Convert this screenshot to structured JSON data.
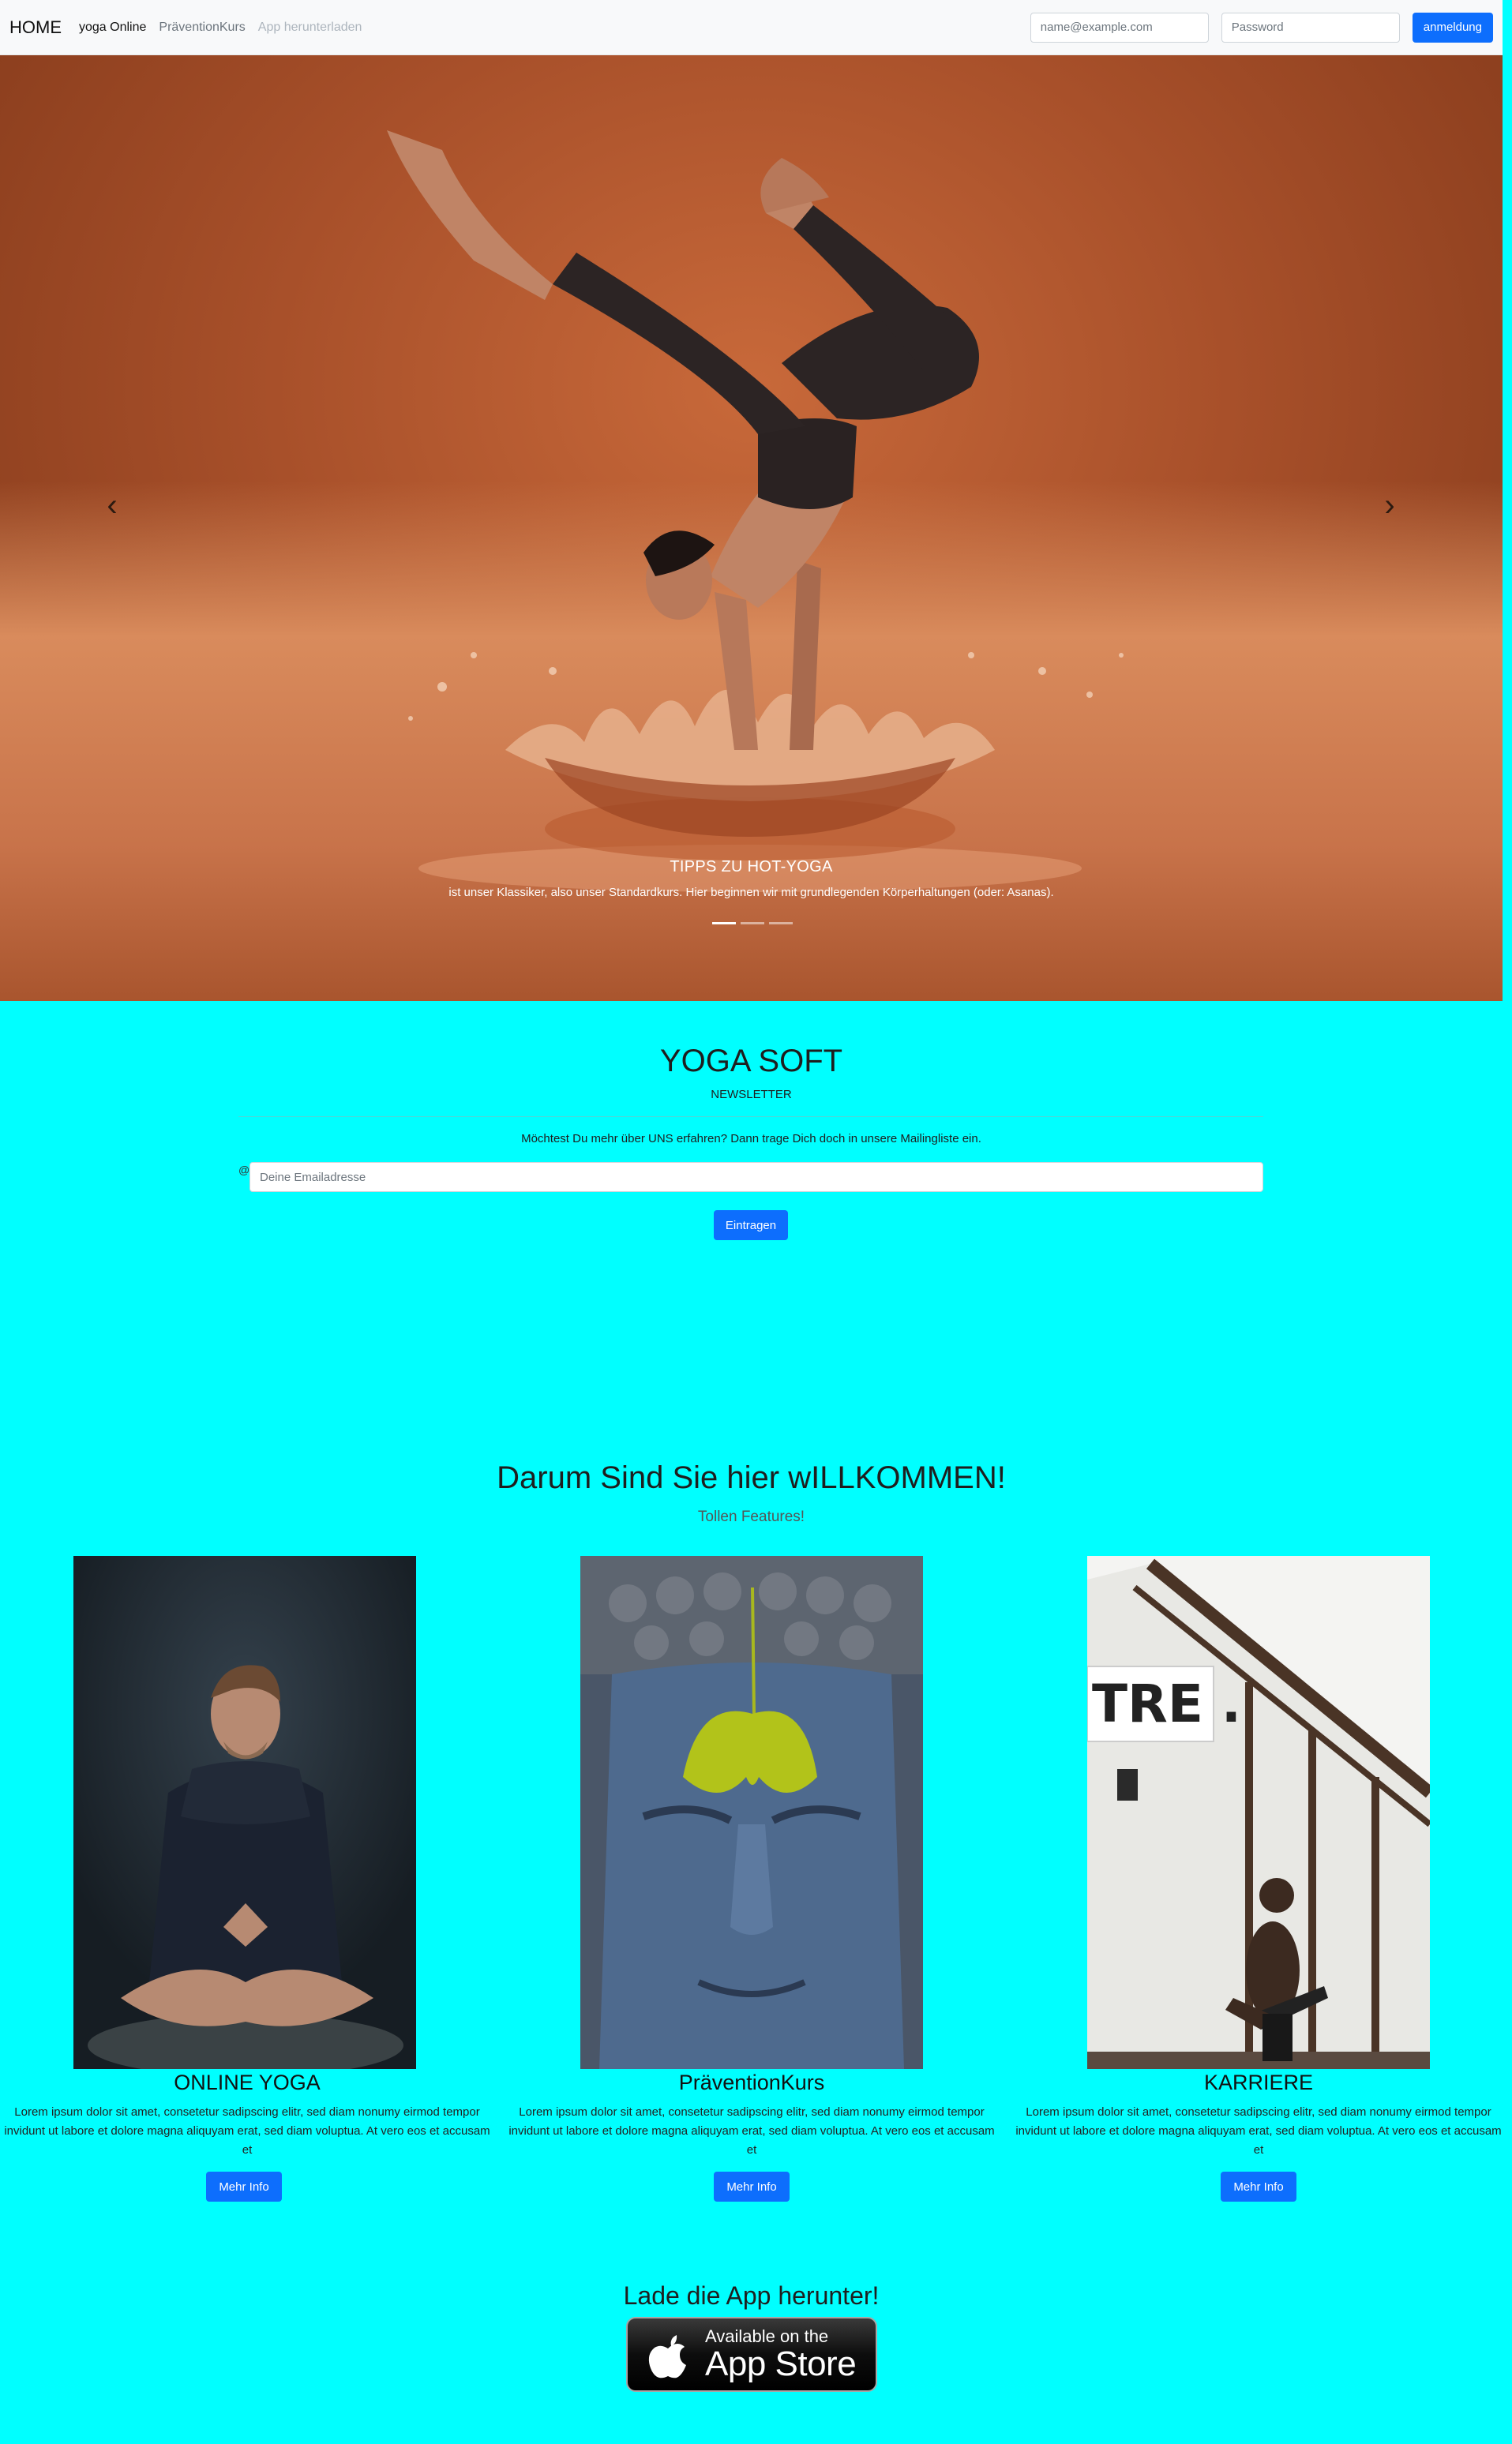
{
  "navbar": {
    "brand": "HOME",
    "links": [
      "yoga Online",
      "PräventionKurs",
      "App herunterladen"
    ],
    "email_placeholder": "name@example.com",
    "password_placeholder": "Password",
    "login_label": "anmeldung"
  },
  "carousel": {
    "prev_icon": "‹",
    "next_icon": "›",
    "caption_title": "TIPPS ZU HOT-YOGA",
    "caption_text": "ist unser Klassiker, also unser Standardkurs. Hier beginnen wir mit grundlegenden Körperhaltungen (oder: Asanas).",
    "slide_count": 3,
    "active_slide": 1
  },
  "newsletter": {
    "title": "YOGA SOFT",
    "label": "NEWSLETTER",
    "text": "Möchtest Du mehr über UNS erfahren? Dann trage Dich doch in unsere Mailingliste ein.",
    "at_sign": "@",
    "email_placeholder": "Deine Emailadresse",
    "submit_label": "Eintragen"
  },
  "features": {
    "title": "Darum Sind Sie hier wILLKOMMEN!",
    "subtitle": "Tollen Features!",
    "items": [
      {
        "heading": "ONLINE YOGA",
        "text": "Lorem ipsum dolor sit amet, consetetur sadipscing elitr, sed diam nonumy eirmod tempor invidunt ut labore et dolore magna aliquyam erat, sed diam voluptua. At vero eos et accusam et",
        "button": "Mehr Info"
      },
      {
        "heading": "PräventionKurs",
        "text": "Lorem ipsum dolor sit amet, consetetur sadipscing elitr, sed diam nonumy eirmod tempor invidunt ut labore et dolore magna aliquyam erat, sed diam voluptua. At vero eos et accusam et",
        "button": "Mehr Info"
      },
      {
        "heading": "KARRIERE",
        "text": "Lorem ipsum dolor sit amet, consetetur sadipscing elitr, sed diam nonumy eirmod tempor invidunt ut labore et dolore magna aliquyam erat, sed diam voluptua. At vero eos et accusam et",
        "button": "Mehr Info"
      }
    ],
    "sign_text": "TRE ."
  },
  "app": {
    "title": "Lade die App herunter!",
    "badge_small": "Available on the",
    "badge_big": "App Store"
  },
  "colors": {
    "page_background": "#00ffff",
    "button_blue": "#0d6efd",
    "navbar_background": "#f8f9fa"
  }
}
